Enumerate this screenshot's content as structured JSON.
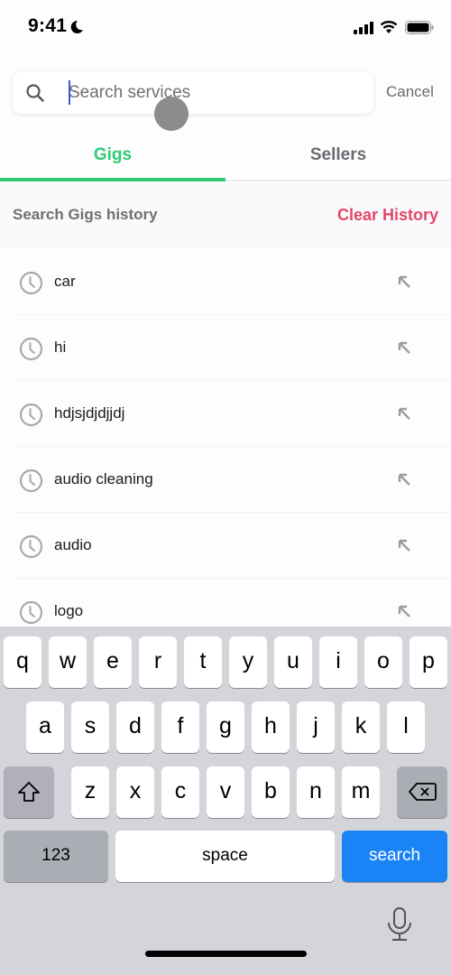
{
  "status_bar": {
    "time": "9:41",
    "icons": [
      "moon-icon",
      "cellular-signal-icon",
      "wifi-icon",
      "battery-icon"
    ]
  },
  "search": {
    "placeholder": "Search services",
    "value": "",
    "cancel_label": "Cancel",
    "icon": "search-icon"
  },
  "tabs": [
    {
      "label": "Gigs",
      "active": true
    },
    {
      "label": "Sellers",
      "active": false
    }
  ],
  "history": {
    "title": "Search Gigs history",
    "clear_label": "Clear History",
    "items": [
      {
        "label": "car"
      },
      {
        "label": "hi"
      },
      {
        "label": "hdjsjdjdjjdj"
      },
      {
        "label": "audio cleaning"
      },
      {
        "label": "audio"
      },
      {
        "label": "logo"
      }
    ]
  },
  "keyboard": {
    "row1": [
      "q",
      "w",
      "e",
      "r",
      "t",
      "y",
      "u",
      "i",
      "o",
      "p"
    ],
    "row2": [
      "a",
      "s",
      "d",
      "f",
      "g",
      "h",
      "j",
      "k",
      "l"
    ],
    "row3": [
      "z",
      "x",
      "c",
      "v",
      "b",
      "n",
      "m"
    ],
    "numbers_label": "123",
    "space_label": "space",
    "action_label": "search"
  },
  "colors": {
    "accent_green": "#2ecc71",
    "clear_red": "#e2486a",
    "keyboard_blue": "#1a84f7"
  }
}
